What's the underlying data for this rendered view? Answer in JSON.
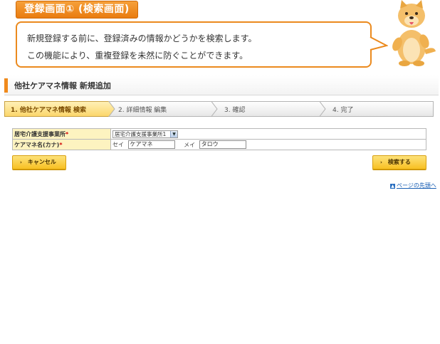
{
  "tutorial": {
    "tab_title": "登録画面① (検索画面)",
    "line1": "新規登録する前に、登録済みの情報かどうかを検索します。",
    "line2": "この機能により、重複登録を未然に防ぐことができます。"
  },
  "page": {
    "title": "他社ケアマネ情報 新規追加"
  },
  "steps": [
    {
      "label": "1. 他社ケアマネ情報 検索",
      "active": true
    },
    {
      "label": "2. 詳細情報 編集",
      "active": false
    },
    {
      "label": "3. 確認",
      "active": false
    },
    {
      "label": "4. 完了",
      "active": false
    }
  ],
  "form": {
    "office": {
      "label": "居宅介護支援事業所",
      "required_mark": "*",
      "selected": "居宅介護支援事業所1"
    },
    "name_kana": {
      "label": "ケアマネ名(カナ)",
      "required_mark": "*",
      "sei_label": "セイ",
      "sei_value": "ケアマネ",
      "mei_label": "メイ",
      "mei_value": "タロウ"
    }
  },
  "buttons": {
    "cancel": "キャンセル",
    "search": "検索する"
  },
  "links": {
    "page_top": "ページの先頭へ"
  },
  "colors": {
    "accent_orange": "#eb8a1e",
    "label_bg": "#fdf3c0",
    "button_yellow": "#f8c022",
    "link_blue": "#1a5fb4"
  }
}
